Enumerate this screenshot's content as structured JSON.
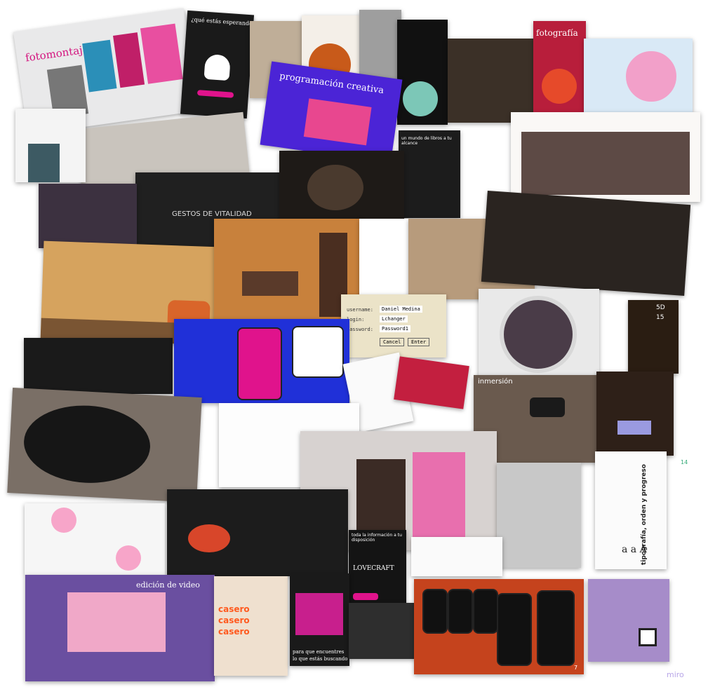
{
  "board": {
    "watermark": "miro"
  },
  "cards": {
    "fotomontaje": {
      "title": "fotomontaje"
    },
    "que_estas_esperando": {
      "title": "¿qué estás esperando?"
    },
    "programacion_creativa": {
      "title": "programación creativa"
    },
    "fotografia": {
      "title": "fotografía"
    },
    "libros": {
      "title": "un mundo de libros a tu alcance"
    },
    "gestos": {
      "title": "GESTOS DE VITALIDAD"
    },
    "login": {
      "username_label": "username:",
      "username_value": "Daniel Medina",
      "login_label": "login:",
      "login_value": "Lchanger",
      "password_label": "password:",
      "password_value": "Password1",
      "cancel_label": "Cancel",
      "enter_label": "Enter"
    },
    "inmersion": {
      "title": "inmersión"
    },
    "chess": {
      "label_5d": "5D",
      "label_15": "15"
    },
    "tipografia": {
      "title": "tipografía, orden y progreso",
      "sample": "a a A"
    },
    "edicion_video": {
      "title": "edición de video"
    },
    "casero": {
      "line": "casero"
    },
    "lovecraft": {
      "heading": "toda la información a tu disposición",
      "name": "LOVECRAFT"
    },
    "para_que": {
      "line1": "para que encuentres",
      "line2": "lo que estás buscando"
    },
    "page_numbers": {
      "p14": "14",
      "p7": "7"
    }
  },
  "colors": {
    "magenta": "#e0138c",
    "purple": "#5a2ad8",
    "orange": "#ff5a1f",
    "pink": "#f3a7d3"
  }
}
